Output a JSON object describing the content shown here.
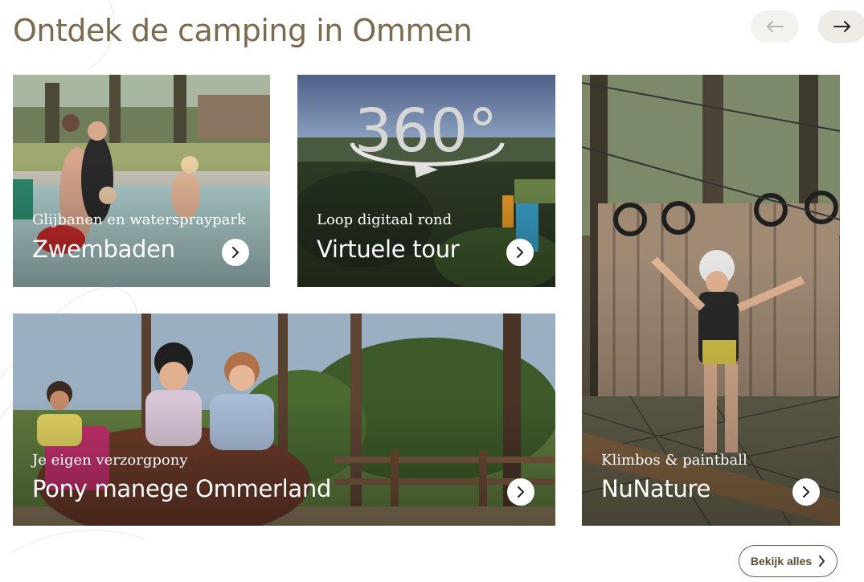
{
  "section": {
    "title": "Ontdek de camping in Ommen"
  },
  "carousel": {
    "prev_icon": "arrow-left-icon",
    "next_icon": "arrow-right-icon"
  },
  "cards": [
    {
      "subtitle": "Glijbanen en waterspraypark",
      "title": "Zwembaden",
      "image": "family-pool-photo",
      "icon": "chevron-right-icon"
    },
    {
      "subtitle": "Loop digitaal rond",
      "title": "Virtuele tour",
      "image": "aerial-360-photo",
      "overlay_text": "360°",
      "icon": "chevron-right-icon"
    },
    {
      "subtitle": "Klimbos & paintball",
      "title": "NuNature",
      "image": "climbing-forest-photo",
      "icon": "chevron-right-icon"
    },
    {
      "subtitle": "Je eigen verzorgpony",
      "title": "Pony manege Ommerland",
      "image": "girls-with-pony-photo",
      "icon": "chevron-right-icon"
    }
  ],
  "footer": {
    "view_all_label": "Bekijk alles",
    "view_all_icon": "chevron-right-icon"
  },
  "colors": {
    "title": "#7a6a50",
    "button_border": "#6d5f4a",
    "nav_bg": "#f4f2ef"
  }
}
